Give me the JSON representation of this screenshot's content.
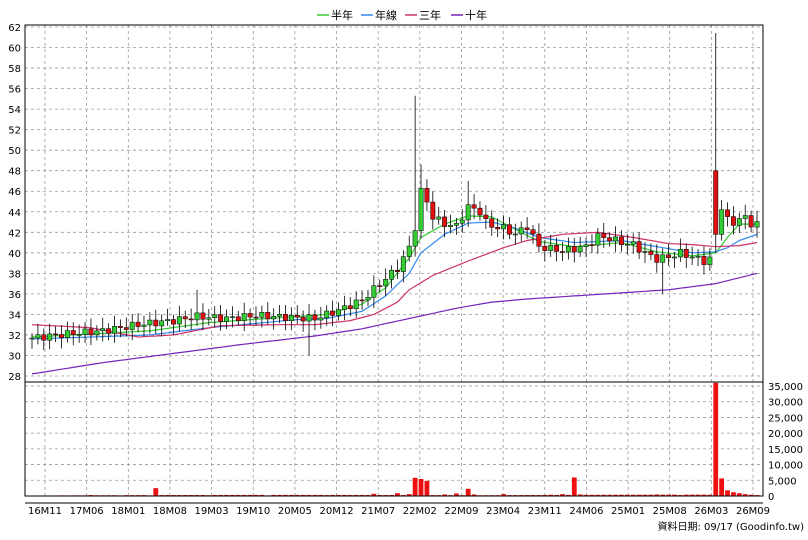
{
  "chart_data": {
    "type": "candlestick",
    "legend": [
      {
        "name": "半年",
        "color": "#33cc33"
      },
      {
        "name": "年線",
        "color": "#3388ee"
      },
      {
        "name": "三年",
        "color": "#cc3366"
      },
      {
        "name": "十年",
        "color": "#7722bb"
      }
    ],
    "legend_placement": "top-center",
    "grid": true,
    "price_axis": {
      "ylim": [
        28,
        62
      ],
      "ticks": [
        28,
        30,
        32,
        34,
        36,
        38,
        40,
        42,
        44,
        46,
        48,
        50,
        52,
        54,
        56,
        58,
        60,
        62
      ]
    },
    "volume_axis": {
      "ylim": [
        0,
        35000
      ],
      "ticks": [
        "0",
        "5,000",
        "10,000",
        "15,000",
        "20,000",
        "25,000",
        "30,000",
        "35,000"
      ]
    },
    "x_ticks": [
      "16M11",
      "17M06",
      "18M01",
      "18M08",
      "19M03",
      "19M10",
      "20M05",
      "20M12",
      "21M07",
      "22M02",
      "22M09",
      "23M04",
      "23M11",
      "24M06",
      "25M01",
      "25M08",
      "26M03",
      "26M09"
    ],
    "footer": "資料日期: 09/17  (Goodinfo.tw)",
    "colors": {
      "up": "#33cc33",
      "down": "#dd1111",
      "volume": "#ee1111",
      "grid": "#999999"
    },
    "keypoints": [
      [
        0,
        31.7
      ],
      [
        6,
        32.1
      ],
      [
        12,
        32.4
      ],
      [
        18,
        33.0
      ],
      [
        24,
        33.4
      ],
      [
        28,
        33.8
      ],
      [
        33,
        33.6
      ],
      [
        38,
        33.9
      ],
      [
        44,
        33.7
      ],
      [
        48,
        33.6
      ],
      [
        52,
        34.4
      ],
      [
        56,
        35.4
      ],
      [
        60,
        37.5
      ],
      [
        62,
        38.5
      ],
      [
        64,
        40.5
      ],
      [
        65,
        42.5
      ],
      [
        66,
        46.0
      ],
      [
        67,
        45.0
      ],
      [
        68,
        43.5
      ],
      [
        70,
        42.8
      ],
      [
        72,
        42.6
      ],
      [
        74,
        44.5
      ],
      [
        76,
        44.0
      ],
      [
        77,
        43.0
      ],
      [
        78,
        42.6
      ],
      [
        80,
        42.4
      ],
      [
        82,
        41.8
      ],
      [
        84,
        42.6
      ],
      [
        86,
        40.6
      ],
      [
        88,
        40.4
      ],
      [
        90,
        40.2
      ],
      [
        92,
        40.4
      ],
      [
        94,
        40.6
      ],
      [
        96,
        41.6
      ],
      [
        98,
        41.4
      ],
      [
        100,
        41.0
      ],
      [
        102,
        40.8
      ],
      [
        104,
        40.0
      ],
      [
        106,
        39.4
      ],
      [
        108,
        39.6
      ],
      [
        110,
        40.0
      ],
      [
        112,
        39.6
      ],
      [
        114,
        39.2
      ],
      [
        116,
        39.6
      ],
      [
        117,
        44.5
      ],
      [
        118,
        43.2
      ],
      [
        119,
        42.8
      ],
      [
        120,
        43.5
      ],
      [
        121,
        43.3
      ],
      [
        122,
        42.8
      ],
      [
        123,
        43.0
      ]
    ],
    "spikes": [
      {
        "i": 65,
        "high": 55.3
      },
      {
        "i": 66,
        "high": 48.6
      },
      {
        "i": 68,
        "high": 46.0
      },
      {
        "i": 74,
        "high": 47.0
      },
      {
        "i": 116,
        "high": 61.4,
        "low": 40.0,
        "open": 48.0,
        "close": 41.8
      },
      {
        "i": 107,
        "low": 36.0
      },
      {
        "i": 47,
        "low": 30.0
      },
      {
        "i": 28,
        "high": 36.4
      }
    ],
    "ma_curves": {
      "半年": [
        [
          0,
          31.8
        ],
        [
          20,
          32.4
        ],
        [
          30,
          33.2
        ],
        [
          45,
          33.8
        ],
        [
          50,
          34.0
        ],
        [
          56,
          35.0
        ],
        [
          60,
          36.6
        ],
        [
          64,
          39.5
        ],
        [
          66,
          41.5
        ],
        [
          70,
          42.8
        ],
        [
          74,
          43.6
        ],
        [
          78,
          43.5
        ],
        [
          82,
          42.3
        ],
        [
          86,
          41.1
        ],
        [
          92,
          40.6
        ],
        [
          100,
          41.0
        ],
        [
          106,
          40.1
        ],
        [
          112,
          39.7
        ],
        [
          116,
          40.0
        ],
        [
          118,
          41.5
        ],
        [
          120,
          42.8
        ],
        [
          123,
          42.8
        ]
      ],
      "年線": [
        [
          0,
          31.6
        ],
        [
          20,
          32.0
        ],
        [
          30,
          32.7
        ],
        [
          45,
          33.5
        ],
        [
          50,
          33.6
        ],
        [
          56,
          34.3
        ],
        [
          60,
          35.8
        ],
        [
          64,
          38.0
        ],
        [
          66,
          40.0
        ],
        [
          70,
          41.8
        ],
        [
          74,
          42.9
        ],
        [
          78,
          43.0
        ],
        [
          82,
          42.4
        ],
        [
          86,
          41.5
        ],
        [
          92,
          41.0
        ],
        [
          100,
          41.2
        ],
        [
          106,
          40.6
        ],
        [
          112,
          40.0
        ],
        [
          116,
          40.1
        ],
        [
          118,
          40.5
        ],
        [
          120,
          41.2
        ],
        [
          123,
          41.8
        ]
      ],
      "三年": [
        [
          0,
          33.0
        ],
        [
          10,
          32.7
        ],
        [
          18,
          31.8
        ],
        [
          24,
          32.0
        ],
        [
          32,
          32.9
        ],
        [
          42,
          33.0
        ],
        [
          48,
          33.0
        ],
        [
          54,
          33.4
        ],
        [
          58,
          34.0
        ],
        [
          62,
          35.2
        ],
        [
          64,
          36.4
        ],
        [
          68,
          37.8
        ],
        [
          74,
          39.2
        ],
        [
          80,
          40.5
        ],
        [
          84,
          41.2
        ],
        [
          90,
          41.8
        ],
        [
          96,
          42.0
        ],
        [
          102,
          41.5
        ],
        [
          108,
          40.9
        ],
        [
          112,
          40.8
        ],
        [
          116,
          40.6
        ],
        [
          120,
          40.7
        ],
        [
          123,
          41.0
        ]
      ],
      "十年": [
        [
          0,
          28.2
        ],
        [
          12,
          29.3
        ],
        [
          24,
          30.2
        ],
        [
          36,
          31.1
        ],
        [
          48,
          31.9
        ],
        [
          56,
          32.6
        ],
        [
          64,
          33.6
        ],
        [
          72,
          34.6
        ],
        [
          78,
          35.2
        ],
        [
          84,
          35.5
        ],
        [
          92,
          35.8
        ],
        [
          100,
          36.1
        ],
        [
          108,
          36.4
        ],
        [
          116,
          37.0
        ],
        [
          123,
          38.0
        ]
      ]
    },
    "volumes": [
      [
        0,
        150
      ],
      [
        5,
        200
      ],
      [
        10,
        300
      ],
      [
        15,
        200
      ],
      [
        20,
        200
      ],
      [
        21,
        2500
      ],
      [
        22,
        300
      ],
      [
        30,
        250
      ],
      [
        40,
        200
      ],
      [
        50,
        300
      ],
      [
        58,
        700
      ],
      [
        62,
        900
      ],
      [
        64,
        600
      ],
      [
        65,
        5800
      ],
      [
        66,
        5400
      ],
      [
        67,
        4800
      ],
      [
        70,
        500
      ],
      [
        72,
        800
      ],
      [
        74,
        2300
      ],
      [
        75,
        500
      ],
      [
        80,
        600
      ],
      [
        88,
        400
      ],
      [
        90,
        600
      ],
      [
        92,
        5900
      ],
      [
        93,
        500
      ],
      [
        100,
        400
      ],
      [
        106,
        500
      ],
      [
        110,
        300
      ],
      [
        115,
        400
      ],
      [
        116,
        36000
      ],
      [
        117,
        5600
      ],
      [
        118,
        1800
      ],
      [
        119,
        1200
      ],
      [
        120,
        900
      ],
      [
        121,
        600
      ],
      [
        122,
        400
      ],
      [
        123,
        300
      ]
    ]
  }
}
